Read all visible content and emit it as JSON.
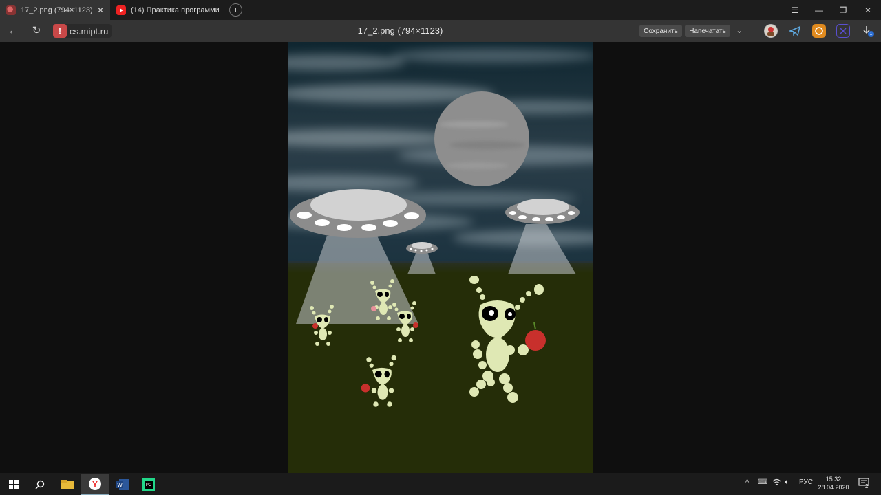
{
  "tabs": [
    {
      "title": "17_2.png (794×1123)",
      "active": true,
      "favicon": "image-favicon"
    },
    {
      "title": "(14) Практика программи",
      "active": false,
      "favicon": "youtube-favicon"
    }
  ],
  "window_controls": [
    "menu-icon",
    "minimize-icon",
    "restore-icon",
    "close-icon"
  ],
  "address_bar": {
    "security_icon": "warning-icon",
    "domain": "cs.mipt.ru",
    "page_title": "17_2.png (794×1123)",
    "save_label": "Сохранить",
    "print_label": "Напечатать"
  },
  "extensions": [
    "profile-icon",
    "telegram-icon",
    "whatsapp-icon",
    "extension-icon",
    "downloads-icon"
  ],
  "downloads_badge": "1",
  "image": {
    "sky_color": "#1e3540",
    "ground_color": "#252d08",
    "alien_color": "#dfe8b4",
    "apple_color": "#c8302c"
  },
  "taskbar": {
    "apps": [
      "windows-start-icon",
      "search-icon",
      "file-explorer-icon",
      "yandex-browser-icon",
      "word-icon",
      "pycharm-icon"
    ],
    "tray": {
      "language": "РУС",
      "time": "15:32",
      "date": "28.04.2020",
      "notifications": "2"
    }
  }
}
